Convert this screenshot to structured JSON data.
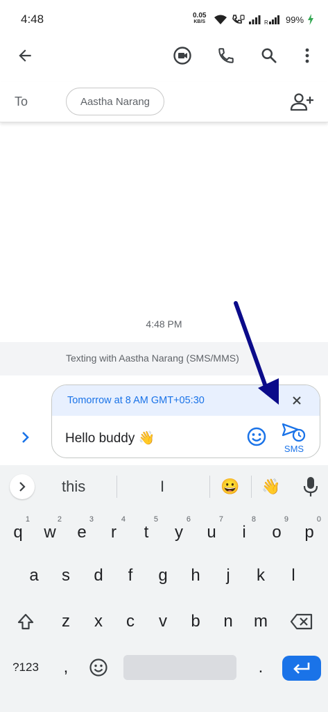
{
  "status_bar": {
    "time": "4:48",
    "net_speed": "0.05",
    "net_unit": "KB/S",
    "battery": "99%"
  },
  "appbar": {
    "icons": [
      "back-arrow-icon",
      "video-call-icon",
      "phone-icon",
      "search-icon",
      "more-vert-icon"
    ]
  },
  "to_row": {
    "label": "To",
    "recipient": "Aastha Narang"
  },
  "conversation": {
    "timestamp": "4:48 PM",
    "banner": "Texting with Aastha Narang (SMS/MMS)"
  },
  "compose": {
    "schedule": "Tomorrow at 8 AM GMT+05:30",
    "message": "Hello buddy 👋",
    "send_label": "SMS"
  },
  "keyboard": {
    "suggestions": [
      "this",
      "I",
      "😀",
      "👋"
    ],
    "row1": [
      {
        "k": "q",
        "n": "1"
      },
      {
        "k": "w",
        "n": "2"
      },
      {
        "k": "e",
        "n": "3"
      },
      {
        "k": "r",
        "n": "4"
      },
      {
        "k": "t",
        "n": "5"
      },
      {
        "k": "y",
        "n": "6"
      },
      {
        "k": "u",
        "n": "7"
      },
      {
        "k": "i",
        "n": "8"
      },
      {
        "k": "o",
        "n": "9"
      },
      {
        "k": "p",
        "n": "0"
      }
    ],
    "row2": [
      "a",
      "s",
      "d",
      "f",
      "g",
      "h",
      "j",
      "k",
      "l"
    ],
    "row3": [
      "z",
      "x",
      "c",
      "v",
      "b",
      "n",
      "m"
    ],
    "symbols_key": "?123",
    "comma_key": ",",
    "period_key": "."
  },
  "colors": {
    "accent": "#1a73e8",
    "schedule_bg": "#e8f0fe",
    "annotation_arrow": "#0b0b8a"
  }
}
